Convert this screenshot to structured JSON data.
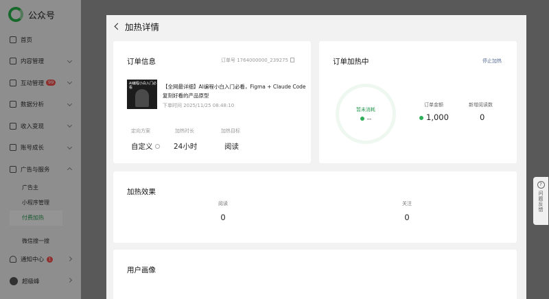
{
  "sidebar": {
    "logo_text": "公众号",
    "items": [
      {
        "label": "首页",
        "icon": "home-icon"
      },
      {
        "label": "内容管理",
        "icon": "content-icon"
      },
      {
        "label": "互动管理",
        "icon": "interaction-icon",
        "badge": "99"
      },
      {
        "label": "数据分析",
        "icon": "analytics-icon"
      },
      {
        "label": "收入变现",
        "icon": "income-icon"
      },
      {
        "label": "账号成长",
        "icon": "growth-icon"
      },
      {
        "label": "广告与服务",
        "icon": "ads-icon"
      }
    ],
    "sub_items": [
      "广告主",
      "小程序管理",
      "付费加热"
    ],
    "extra_item": "微信搜一搜",
    "notification": {
      "label": "通知中心",
      "badge": "1"
    },
    "user": {
      "label": "超级峰"
    }
  },
  "panel": {
    "title": "加热详情"
  },
  "order_info": {
    "title": "订单信息",
    "order_id": "订单号 1764000000_239275",
    "thumb_text": "AI编程小白入门必看",
    "article_title": "【全网最详细】AI编程小白入门必看，Figma + Claude Code复刻好看的产品原型",
    "order_time": "下单时间 2025/11/25 08:48:10",
    "meta": [
      {
        "label": "定向方案",
        "value": "自定义"
      },
      {
        "label": "加热时长",
        "value": "24小时"
      },
      {
        "label": "加热目标",
        "value": "阅读"
      }
    ]
  },
  "status": {
    "title": "订单加热中",
    "stop_label": "停止加热",
    "ring_label": "暂未消耗",
    "ring_value": "--",
    "amount_label": "订单金额",
    "amount_value": "1,000",
    "new_reads_label": "新增阅读数",
    "new_reads_value": "0"
  },
  "effect": {
    "title": "加热效果",
    "stats": [
      {
        "label": "阅读",
        "value": "0"
      },
      {
        "label": "关注",
        "value": "0"
      }
    ]
  },
  "persona": {
    "title": "用户画像"
  },
  "help": {
    "label": "问题反馈"
  }
}
